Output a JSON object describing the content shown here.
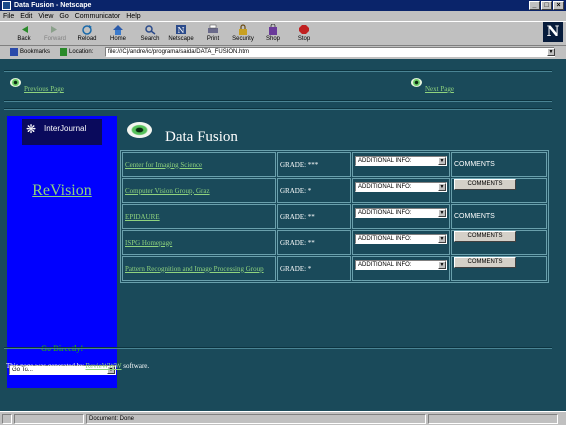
{
  "window": {
    "title": "Data Fusion - Netscape"
  },
  "menu": [
    "File",
    "Edit",
    "View",
    "Go",
    "Communicator",
    "Help"
  ],
  "toolbar": {
    "back": "Back",
    "forward": "Forward",
    "reload": "Reload",
    "home": "Home",
    "search": "Search",
    "netscape": "Netscape",
    "print": "Print",
    "security": "Security",
    "shop": "Shop",
    "stop": "Stop"
  },
  "location": {
    "bookmarks_label": "Bookmarks",
    "location_label": "Location:",
    "url": "file:///C|/andre/ic/programa/saida/DATA_FUSION.htm"
  },
  "page": {
    "previous": "Previous Page",
    "next": "Next Page",
    "interjournal": "InterJournal",
    "revision": "ReVision",
    "go_directly": "Go Directly!",
    "goto_value": "Go To...",
    "title": "Data Fusion",
    "rows": [
      {
        "name": "Center for Imaging Science",
        "grade": "GRADE: ***",
        "info": "ADDITIONAL INFO:",
        "comments": "COMMENTS",
        "comments_button": false
      },
      {
        "name": "Computer Vision Group, Graz",
        "grade": "GRADE: *",
        "info": "ADDITIONAL INFO:",
        "comments": "COMMENTS",
        "comments_button": true
      },
      {
        "name": "EPIDAURE",
        "grade": "GRADE: **",
        "info": "ADDITIONAL INFO:",
        "comments": "COMMENTS",
        "comments_button": false
      },
      {
        "name": "ISPG Homepage",
        "grade": "GRADE: **",
        "info": "ADDITIONAL INFO:",
        "comments": "COMMENTS",
        "comments_button": true
      },
      {
        "name": "Pattern Recognition and Image Processing Group",
        "grade": "GRADE: *",
        "info": "ADDITIONAL INFO:",
        "comments": "COMMENTS",
        "comments_button": true
      }
    ],
    "footer_pre": "This page was generated by ",
    "footer_link": "RevieWWW",
    "footer_post": " software."
  },
  "status": {
    "text": "Document: Done"
  },
  "colors": {
    "page_bg": "#1a4a5a",
    "link": "#8fd37e",
    "panel": "#0000ff"
  }
}
